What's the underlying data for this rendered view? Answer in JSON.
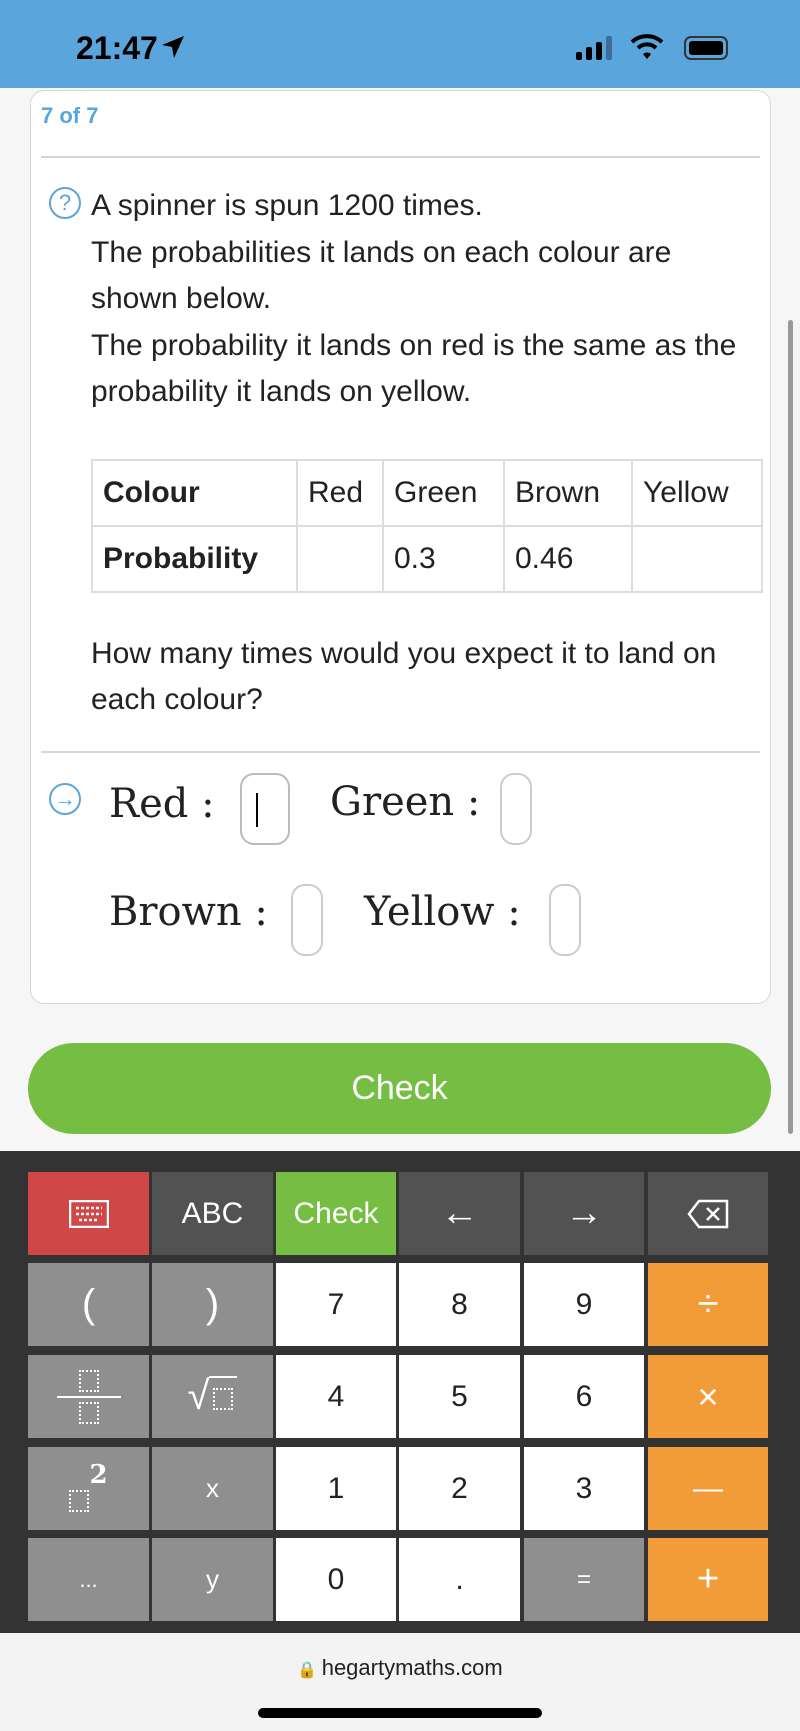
{
  "status_bar": {
    "time": "21:47",
    "icons": [
      "location-arrow-icon",
      "signal-icon",
      "wifi-icon",
      "battery-icon"
    ]
  },
  "question": {
    "counter": "7 of 7",
    "lines": [
      "A spinner is spun 1200 times.",
      "The probabilities it lands on each colour are shown below.",
      "The probability it lands on red is the same as the probability it lands on yellow."
    ],
    "table": {
      "headers": [
        "Colour",
        "Red",
        "Green",
        "Brown",
        "Yellow"
      ],
      "row": [
        "Probability",
        "",
        "0.3",
        "0.46",
        ""
      ]
    },
    "prompt": "How many times would you expect it to land on each colour?"
  },
  "answers": [
    {
      "label": "Red :",
      "value": ""
    },
    {
      "label": "Green :",
      "value": ""
    },
    {
      "label": "Brown :",
      "value": ""
    },
    {
      "label": "Yellow :",
      "value": ""
    }
  ],
  "check_label": "Check",
  "keyboard": {
    "row1": [
      "keyboard-icon",
      "ABC",
      "Check",
      "←",
      "→",
      "backspace-icon"
    ],
    "keys": {
      "lparen": "(",
      "rparen": ")",
      "seven": "7",
      "eight": "8",
      "nine": "9",
      "divide": "÷",
      "four": "4",
      "five": "5",
      "six": "6",
      "times": "×",
      "x": "x",
      "one": "1",
      "two": "2",
      "three": "3",
      "minus": "—",
      "dots": "...",
      "y": "y",
      "zero": "0",
      "point": ".",
      "equals": "=",
      "plus": "+",
      "power": "2"
    }
  },
  "browser": {
    "url": "hegartymaths.com"
  },
  "colors": {
    "brand_blue": "#5aa5dc",
    "check_green": "#76bd43",
    "operator_orange": "#f19c38",
    "keyboard_red": "#d14646"
  }
}
